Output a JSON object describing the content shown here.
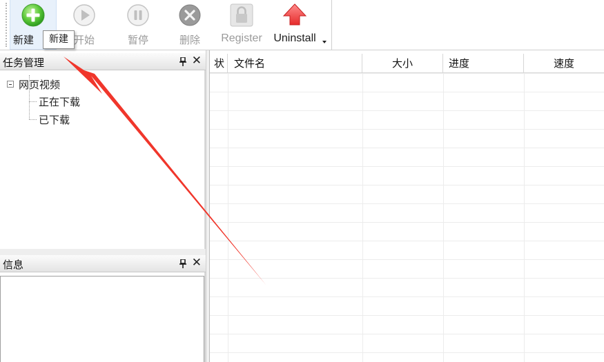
{
  "toolbar": {
    "buttons": [
      {
        "id": "new",
        "label": "新建",
        "icon": "plus-circle-icon"
      },
      {
        "id": "start",
        "label": "开始",
        "icon": "play-circle-icon"
      },
      {
        "id": "pause",
        "label": "暂停",
        "icon": "pause-circle-icon"
      },
      {
        "id": "delete",
        "label": "删除",
        "icon": "x-circle-icon"
      },
      {
        "id": "register",
        "label": "Register",
        "icon": "lock-icon"
      },
      {
        "id": "uninstall",
        "label": "Uninstall",
        "icon": "red-up-arrow-icon"
      }
    ],
    "tooltip": "新建"
  },
  "task_panel": {
    "title": "任务管理",
    "pin_glyph": "ꟷ",
    "close_glyph": "✕",
    "tree": {
      "root": "网页视频",
      "children": [
        "正在下载",
        "已下载"
      ]
    }
  },
  "info_panel": {
    "title": "信息"
  },
  "grid": {
    "columns": [
      "状",
      "文件名",
      "大小",
      "进度",
      "速度"
    ]
  },
  "colors": {
    "annotation_arrow": "#f0362b",
    "new_button_bg": "#e8f1fb"
  }
}
